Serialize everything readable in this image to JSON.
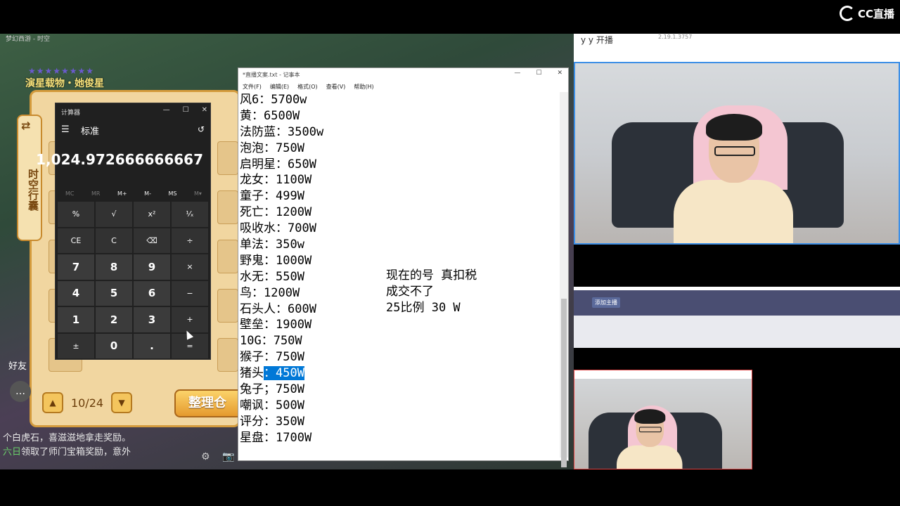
{
  "brand": {
    "logo_text": "CC直播"
  },
  "game": {
    "window_title": "梦幻西游 - 时空",
    "banner_text": "演星载物・她俊星",
    "side_tab_label": "时空行囊",
    "page_indicator": "10/24",
    "sort_button": "整理仓",
    "friends_label": "好友",
    "chat_lines": [
      {
        "tag": "",
        "text": "个白虎石，喜滋滋地拿走奖励。"
      },
      {
        "tag": "六日",
        "text": "领取了师门宝箱奖励，意外"
      }
    ]
  },
  "calculator": {
    "window_title": "计算器",
    "mode": "标准",
    "display": "1,024.972666666667",
    "memory_buttons": [
      "MC",
      "MR",
      "M+",
      "M-",
      "MS",
      "M▾"
    ],
    "keys": [
      "%",
      "√",
      "x²",
      "¹⁄ₓ",
      "CE",
      "C",
      "⌫",
      "÷",
      "7",
      "8",
      "9",
      "×",
      "4",
      "5",
      "6",
      "−",
      "1",
      "2",
      "3",
      "+",
      "±",
      "0",
      ".",
      "="
    ]
  },
  "notepad": {
    "window_title": "*直播文案.txt - 记事本",
    "menu": [
      "文件(F)",
      "编辑(E)",
      "格式(O)",
      "查看(V)",
      "帮助(H)"
    ],
    "lines": [
      "风6：5700w",
      "黄：6500W",
      "法防蓝：3500w",
      "泡泡：750W",
      "启明星：650W",
      "龙女：1100W",
      "童子：499W",
      "死亡：1200W",
      "吸收水：700W",
      "单法：350w",
      "野鬼：1000W",
      "水无：550W",
      "鸟：1200W",
      "石头人：600W",
      "壁垒：1900W",
      "10G：750W",
      "猴子：750W",
      "猪头",
      "兔子；750W",
      "嘲讽：500W",
      "评分：350W",
      "星盘：1700W"
    ],
    "selected_text": "：450W",
    "notes": [
      "现在的号 真扣税",
      "成交不了",
      "25比例 30 W"
    ]
  },
  "stream_panel": {
    "streamer_name": "y y 开播",
    "version": "2.19.1.3757",
    "add_host_button": "添加主播"
  }
}
